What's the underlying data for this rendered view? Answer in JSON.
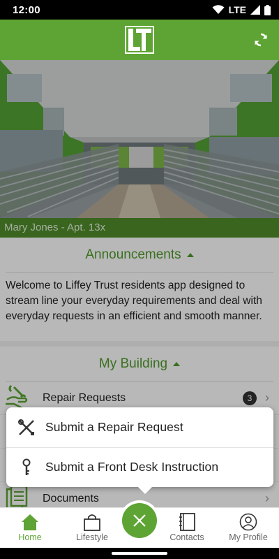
{
  "status": {
    "time": "12:00",
    "network": "LTE"
  },
  "header": {
    "logo_text": "LT"
  },
  "resident": {
    "label": "Mary Jones - Apt. 13x"
  },
  "announcements": {
    "title": "Announcements",
    "text": "Welcome to Liffey Trust residents app designed to stream line your everyday requirements and deal with everyday requests in an efficient and smooth manner."
  },
  "building": {
    "title": "My Building",
    "items": [
      {
        "label": "Repair Requests",
        "badge": "3",
        "icon": "wrench-hand-icon"
      },
      {
        "label": "Documents",
        "icon": "documents-icon"
      }
    ]
  },
  "action_sheet": {
    "items": [
      {
        "label": "Submit a Repair Request",
        "icon": "tools-icon"
      },
      {
        "label": "Submit a Front Desk Instruction",
        "icon": "key-icon"
      }
    ]
  },
  "tabs": [
    {
      "label": "Home",
      "icon": "home-icon",
      "active": true
    },
    {
      "label": "Lifestyle",
      "icon": "shopping-bag-icon"
    },
    {
      "label": "Contacts",
      "icon": "contacts-book-icon"
    },
    {
      "label": "My Profile",
      "icon": "profile-icon"
    }
  ],
  "colors": {
    "brand": "#5ea434",
    "brand_dark": "#4f8c2c"
  }
}
